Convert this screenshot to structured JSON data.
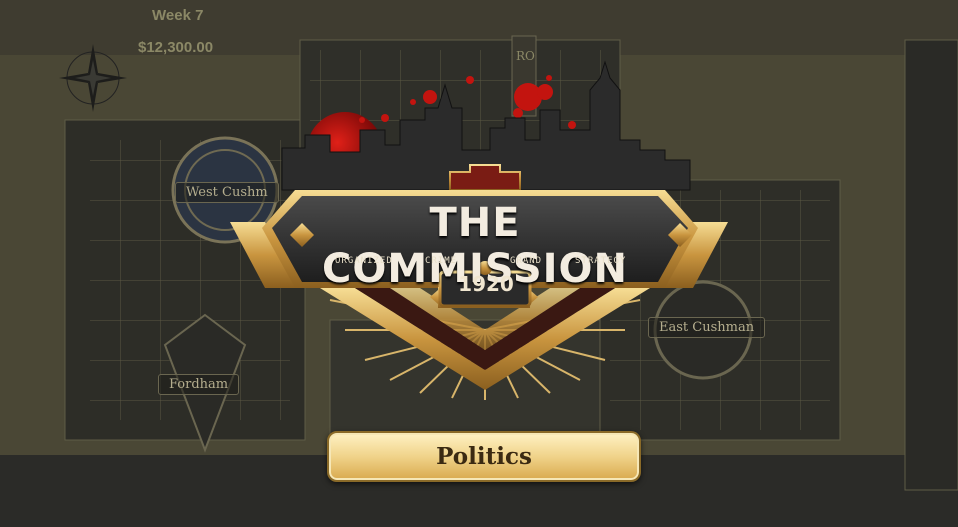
{
  "hud": {
    "week": "Week 7",
    "money": "$12,300.00"
  },
  "districts": {
    "west": "West Cushm",
    "fordham": "Fordham",
    "east": "East Cushman"
  },
  "sign_letters": "RO",
  "logo": {
    "title": "THE COMMISSION",
    "tagline": [
      "ORGANIZED",
      "CRIME",
      "GRAND",
      "STRATEGY"
    ],
    "year": "1920"
  },
  "menu": {
    "button_label": "Politics"
  },
  "icons": {
    "compass": "compass-rose-icon"
  },
  "colors": {
    "gold": "#d9a94d",
    "blood": "#b0100c",
    "dark": "#2b2b2b",
    "map_base": "#3a372c"
  }
}
